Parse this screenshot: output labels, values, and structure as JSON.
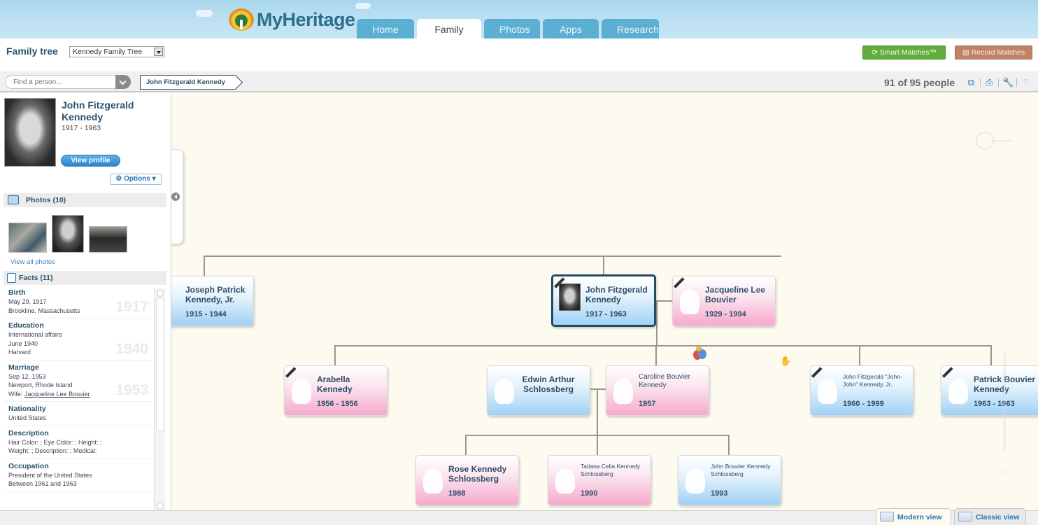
{
  "header": {
    "logo_text": "MyHeritage",
    "tabs": [
      {
        "label": "Home",
        "active": false
      },
      {
        "label": "Family tree",
        "active": true
      },
      {
        "label": "Photos",
        "active": false
      },
      {
        "label": "Apps",
        "active": false
      },
      {
        "label": "Research",
        "active": false
      }
    ]
  },
  "subheader": {
    "title": "Family tree",
    "tree_select_value": "Kennedy Family Tree",
    "smart_matches_label": "Smart Matches™",
    "record_matches_label": "Record Matches"
  },
  "toolbar": {
    "find_placeholder": "Find a person...",
    "breadcrumb": "John Fitzgerald Kennedy",
    "people_count": "91 of 95 people",
    "icons": [
      "fullscreen-icon",
      "print-icon",
      "wrench-icon",
      "help-icon"
    ]
  },
  "profile": {
    "name": "John Fitzgerald Kennedy",
    "dates": "1917 - 1963",
    "view_profile_label": "View profile",
    "options_label": "Options",
    "photos_header": "Photos (10)",
    "view_all_photos": "View all photos",
    "facts_header": "Facts (11)",
    "facts": [
      {
        "title": "Birth",
        "lines": [
          "May 29, 1917",
          "Brookline, Massachusetts"
        ],
        "year": "1917"
      },
      {
        "title": "Education",
        "lines": [
          "International affairs",
          "June 1940",
          "Harvard"
        ],
        "year": "1940"
      },
      {
        "title": "Marriage",
        "lines": [
          "Sep 12, 1953",
          "Newport, Rhode Island"
        ],
        "wife_prefix": "Wife: ",
        "wife_link": "Jacqueline Lee Bouvier",
        "year": "1953"
      },
      {
        "title": "Nationality",
        "lines": [
          "United States"
        ],
        "year": ""
      },
      {
        "title": "Description",
        "lines": [
          "Hair Color: ; Eye Color: ; Height: ;",
          "Weight: ; Description: ; Medical:"
        ],
        "year": ""
      },
      {
        "title": "Occupation",
        "lines": [
          "President of the United States",
          "Between 1961 and 1963"
        ],
        "year": ""
      }
    ]
  },
  "tree": {
    "people": [
      {
        "id": "joseph",
        "name": "Joseph Patrick Kennedy, Jr.",
        "dates": "1915 - 1944",
        "gender": "m",
        "deceased": true
      },
      {
        "id": "jfk",
        "name": "John Fitzgerald Kennedy",
        "dates": "1917 - 1963",
        "gender": "m",
        "deceased": true,
        "selected": true
      },
      {
        "id": "jackie",
        "name": "Jacqueline Lee Bouvier",
        "dates": "1929 - 1994",
        "gender": "f",
        "deceased": true
      },
      {
        "id": "arabella",
        "name": "Arabella Kennedy",
        "dates": "1956 - 1956",
        "gender": "f",
        "deceased": true
      },
      {
        "id": "edwin",
        "name": "Edwin Arthur Schlossberg",
        "dates": "",
        "gender": "m",
        "deceased": false
      },
      {
        "id": "caroline",
        "name": "Caroline Bouvier Kennedy",
        "dates": "1957",
        "gender": "f",
        "deceased": false,
        "birthday": true
      },
      {
        "id": "johnjohn",
        "name": "John Fitzgerald \"John-John\" Kennedy, Jr.",
        "dates": "1960 - 1999",
        "gender": "m",
        "deceased": true
      },
      {
        "id": "patrick",
        "name": "Patrick Bouvier Kennedy",
        "dates": "1963 - 1963",
        "gender": "m",
        "deceased": true
      },
      {
        "id": "rose",
        "name": "Rose Kennedy Schlossberg",
        "dates": "1988",
        "gender": "f",
        "deceased": false
      },
      {
        "id": "tatiana",
        "name": "Tatiana Celia Kennedy Schlossberg",
        "dates": "1990",
        "gender": "f",
        "deceased": false
      },
      {
        "id": "jackschloss",
        "name": "John Bouvier Kennedy Schlossberg",
        "dates": "1993",
        "gender": "m",
        "deceased": false
      }
    ]
  },
  "bottom": {
    "modern_view_label": "Modern view",
    "classic_view_label": "Classic view"
  }
}
